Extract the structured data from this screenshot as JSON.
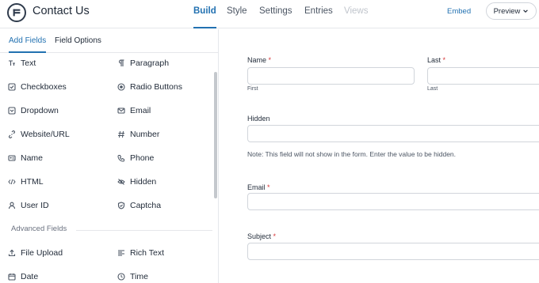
{
  "header": {
    "app_title": "Contact Us",
    "nav": [
      {
        "label": "Build",
        "active": true
      },
      {
        "label": "Style"
      },
      {
        "label": "Settings"
      },
      {
        "label": "Entries"
      },
      {
        "label": "Views",
        "disabled": true
      }
    ],
    "embed_label": "Embed",
    "preview_label": "Preview"
  },
  "sidebar": {
    "tabs": [
      "Add Fields",
      "Field Options"
    ],
    "fields": [
      {
        "label": "Text",
        "icon": "text-icon"
      },
      {
        "label": "Paragraph",
        "icon": "paragraph-icon"
      },
      {
        "label": "Checkboxes",
        "icon": "checkbox-icon"
      },
      {
        "label": "Radio Buttons",
        "icon": "radio-icon"
      },
      {
        "label": "Dropdown",
        "icon": "dropdown-icon"
      },
      {
        "label": "Email",
        "icon": "envelope-icon"
      },
      {
        "label": "Website/URL",
        "icon": "link-icon"
      },
      {
        "label": "Number",
        "icon": "hash-icon"
      },
      {
        "label": "Name",
        "icon": "id-card-icon"
      },
      {
        "label": "Phone",
        "icon": "phone-icon"
      },
      {
        "label": "HTML",
        "icon": "code-icon"
      },
      {
        "label": "Hidden",
        "icon": "eye-slash-icon"
      },
      {
        "label": "User ID",
        "icon": "user-icon"
      },
      {
        "label": "Captcha",
        "icon": "shield-icon"
      }
    ],
    "advanced_section": "Advanced Fields",
    "advanced_fields": [
      {
        "label": "File Upload",
        "icon": "upload-icon"
      },
      {
        "label": "Rich Text",
        "icon": "rich-text-icon"
      },
      {
        "label": "Date",
        "icon": "calendar-icon"
      },
      {
        "label": "Time",
        "icon": "clock-icon"
      }
    ]
  },
  "form": {
    "name_label": "Name",
    "first_sublabel": "First",
    "last_label": "Last",
    "last_sublabel": "Last",
    "hidden_label": "Hidden",
    "hidden_note": "Note: This field will not show in the form. Enter the value to be hidden.",
    "email_label": "Email",
    "subject_label": "Subject",
    "required_marker": "*"
  },
  "colors": {
    "accent": "#2271b1",
    "required": "#d63638",
    "text": "#1f2937"
  }
}
